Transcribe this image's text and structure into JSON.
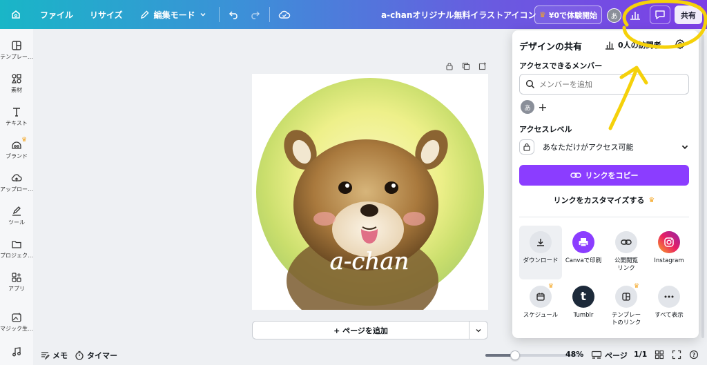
{
  "topbar": {
    "menu": [
      "ファイル",
      "リサイズ"
    ],
    "edit_mode": "編集モード",
    "doc_title": "a-chanオリジナル無料イラストアイコン",
    "trial_label": "¥0で体験開始",
    "avatar_initial": "あ",
    "share_label": "共有"
  },
  "sidebar": {
    "items": [
      {
        "label": "テンプレー…",
        "icon": "template-icon"
      },
      {
        "label": "素材",
        "icon": "elements-icon"
      },
      {
        "label": "テキスト",
        "icon": "text-icon"
      },
      {
        "label": "ブランド",
        "icon": "brand-icon",
        "crown": true
      },
      {
        "label": "アップロー…",
        "icon": "upload-icon"
      },
      {
        "label": "ツール",
        "icon": "draw-icon"
      },
      {
        "label": "プロジェク…",
        "icon": "folder-icon"
      },
      {
        "label": "アプリ",
        "icon": "apps-icon"
      },
      {
        "label": "マジック生…",
        "icon": "magic-media-icon"
      },
      {
        "label": "",
        "icon": "music-icon"
      }
    ]
  },
  "canvas": {
    "signature": "a-chan",
    "add_page_label": "+ ページを追加"
  },
  "bottombar": {
    "notes_label": "メモ",
    "timer_label": "タイマー",
    "zoom_percent": 48,
    "zoom_label": "48%",
    "pages_label": "ページ",
    "page_count": "1/1"
  },
  "share_panel": {
    "title": "デザインの共有",
    "visitors": "0人の訪問者",
    "members_heading": "アクセスできるメンバー",
    "member_search_placeholder": "メンバーを追加",
    "member_initial": "あ",
    "access_heading": "アクセスレベル",
    "access_value": "あなただけがアクセス可能",
    "copy_link_label": "リンクをコピー",
    "customize_label": "リンクをカスタマイズする",
    "options": [
      {
        "label": "ダウンロード",
        "icon": "download-icon"
      },
      {
        "label": "Canvaで印刷",
        "icon": "print-icon"
      },
      {
        "label": "公開閲覧\nリンク",
        "icon": "link-icon"
      },
      {
        "label": "Instagram",
        "icon": "instagram-icon"
      },
      {
        "label": "スケジュール",
        "icon": "calendar-icon",
        "crown": true
      },
      {
        "label": "Tumblr",
        "icon": "tumblr-icon"
      },
      {
        "label": "テンプレー\nトのリンク",
        "icon": "template-link-icon",
        "crown": true
      },
      {
        "label": "すべて表示",
        "icon": "more-icon"
      }
    ]
  },
  "colors": {
    "accent": "#8b3dff",
    "crown": "#f4a623",
    "annotation": "#f5d10a"
  }
}
